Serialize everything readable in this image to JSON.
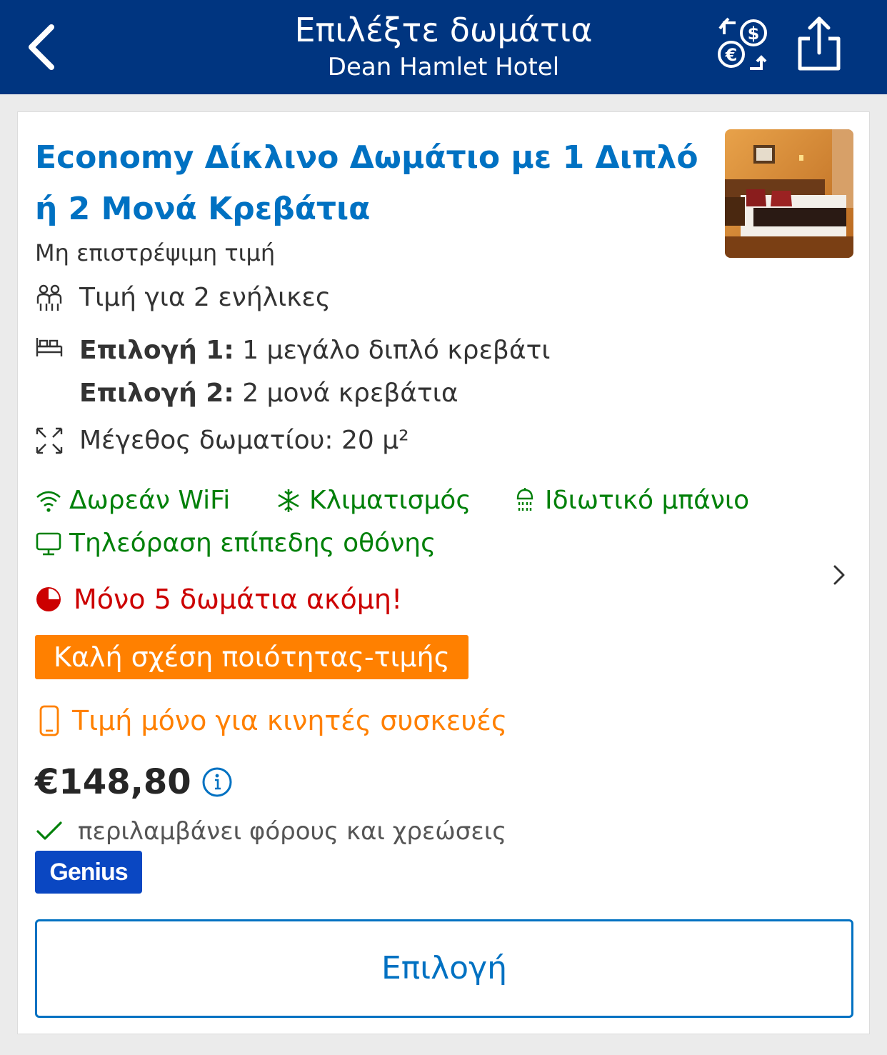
{
  "header": {
    "title": "Επιλέξτε δωμάτια",
    "subtitle": "Dean Hamlet Hotel",
    "back_icon": "chevron-left-icon",
    "currency_icon": "currency-exchange-icon",
    "share_icon": "share-icon",
    "background_color": "#003580"
  },
  "room": {
    "title": "Economy Δίκλινο Δωμάτιο με 1 Διπλό ή 2 Μονά Κρεβάτια",
    "policy": "Μη επιστρέψιμη τιμή",
    "occupancy": "Τιμή για 2 ενήλικες",
    "bed_option_1_label": "Επιλογή 1:",
    "bed_option_1_value": "1 μεγάλο διπλό κρεβάτι",
    "bed_option_2_label": "Επιλογή 2:",
    "bed_option_2_value": "2 μονά κρεβάτια",
    "size": "Μέγεθος δωματίου: 20 μ²",
    "amenities": [
      {
        "label": "Δωρεάν WiFi",
        "icon": "wifi-icon"
      },
      {
        "label": "Κλιματισμός",
        "icon": "snowflake-icon"
      },
      {
        "label": "Ιδιωτικό μπάνιο",
        "icon": "shower-icon"
      },
      {
        "label": "Τηλεόραση επίπεδης οθόνης",
        "icon": "tv-icon"
      }
    ],
    "scarcity": "Μόνο 5 δωμάτια ακόμη!",
    "value_badge": "Καλή σχέση ποιότητας-τιμής",
    "mobile_price": "Τιμή μόνο για κινητές συσκευές",
    "price": "€148,80",
    "taxes": "περιλαμβάνει φόρους και χρεώσεις",
    "genius_badge": "Genius",
    "select_button": "Επιλογή"
  },
  "colors": {
    "brand_blue": "#003580",
    "link_blue": "#0071c2",
    "amenity_green": "#008009",
    "scarcity_red": "#cc0000",
    "deal_orange": "#ff8000",
    "genius_blue": "#0a47c2"
  }
}
